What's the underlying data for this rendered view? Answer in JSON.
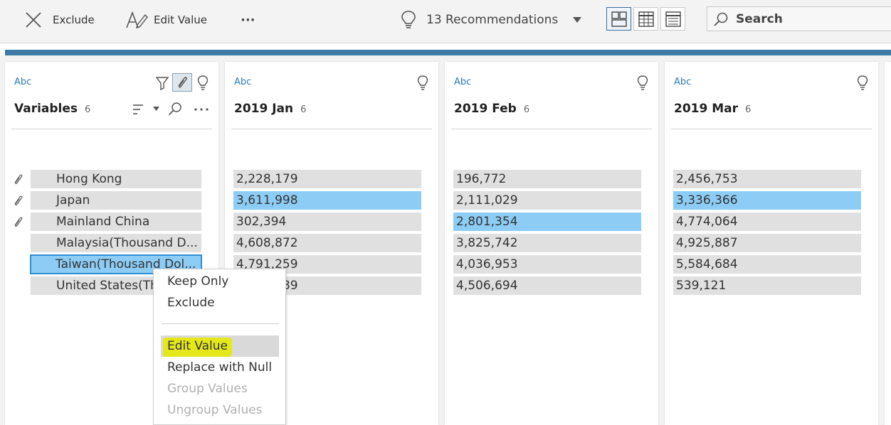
{
  "toolbar": {
    "exclude_label": "Exclude",
    "edit_value_label": "Edit Value",
    "more_label": "···",
    "recommendations_label": "13 Recommendations",
    "search_placeholder": "Search"
  },
  "columns": [
    {
      "type": "Abc",
      "title": "Variables",
      "count": "6",
      "values": [
        "Hong Kong",
        "Japan",
        "Mainland China",
        "Malaysia(Thousand D...",
        "Taiwan(Thousand Dol...",
        "United States(Th"
      ],
      "highlighted": [],
      "selected": [
        4
      ],
      "pinned": [
        0,
        1,
        2
      ]
    },
    {
      "type": "Abc",
      "title": "2019 Jan",
      "count": "6",
      "values": [
        "2,228,179",
        "3,611,998",
        "302,394",
        "4,608,872",
        "4,791,259",
        "4,881,389"
      ],
      "highlighted": [
        1
      ]
    },
    {
      "type": "Abc",
      "title": "2019 Feb",
      "count": "6",
      "values": [
        "196,772",
        "2,111,029",
        "2,801,354",
        "3,825,742",
        "4,036,953",
        "4,506,694"
      ],
      "highlighted": [
        2
      ]
    },
    {
      "type": "Abc",
      "title": "2019 Mar",
      "count": "6",
      "values": [
        "2,456,753",
        "3,336,366",
        "4,774,064",
        "4,925,887",
        "5,584,684",
        "539,121"
      ],
      "highlighted": [
        1
      ]
    }
  ],
  "context_menu": {
    "keep_only": "Keep Only",
    "exclude": "Exclude",
    "edit_value": "Edit Value",
    "replace_null": "Replace with Null",
    "group_values": "Group Values",
    "ungroup_values": "Ungroup Values"
  },
  "colors": {
    "accent_bar": "#3e7ba6",
    "highlight": "#8dcdf5",
    "edit_value_marker": "#e4e81a",
    "type_label": "#2f7bb3"
  }
}
